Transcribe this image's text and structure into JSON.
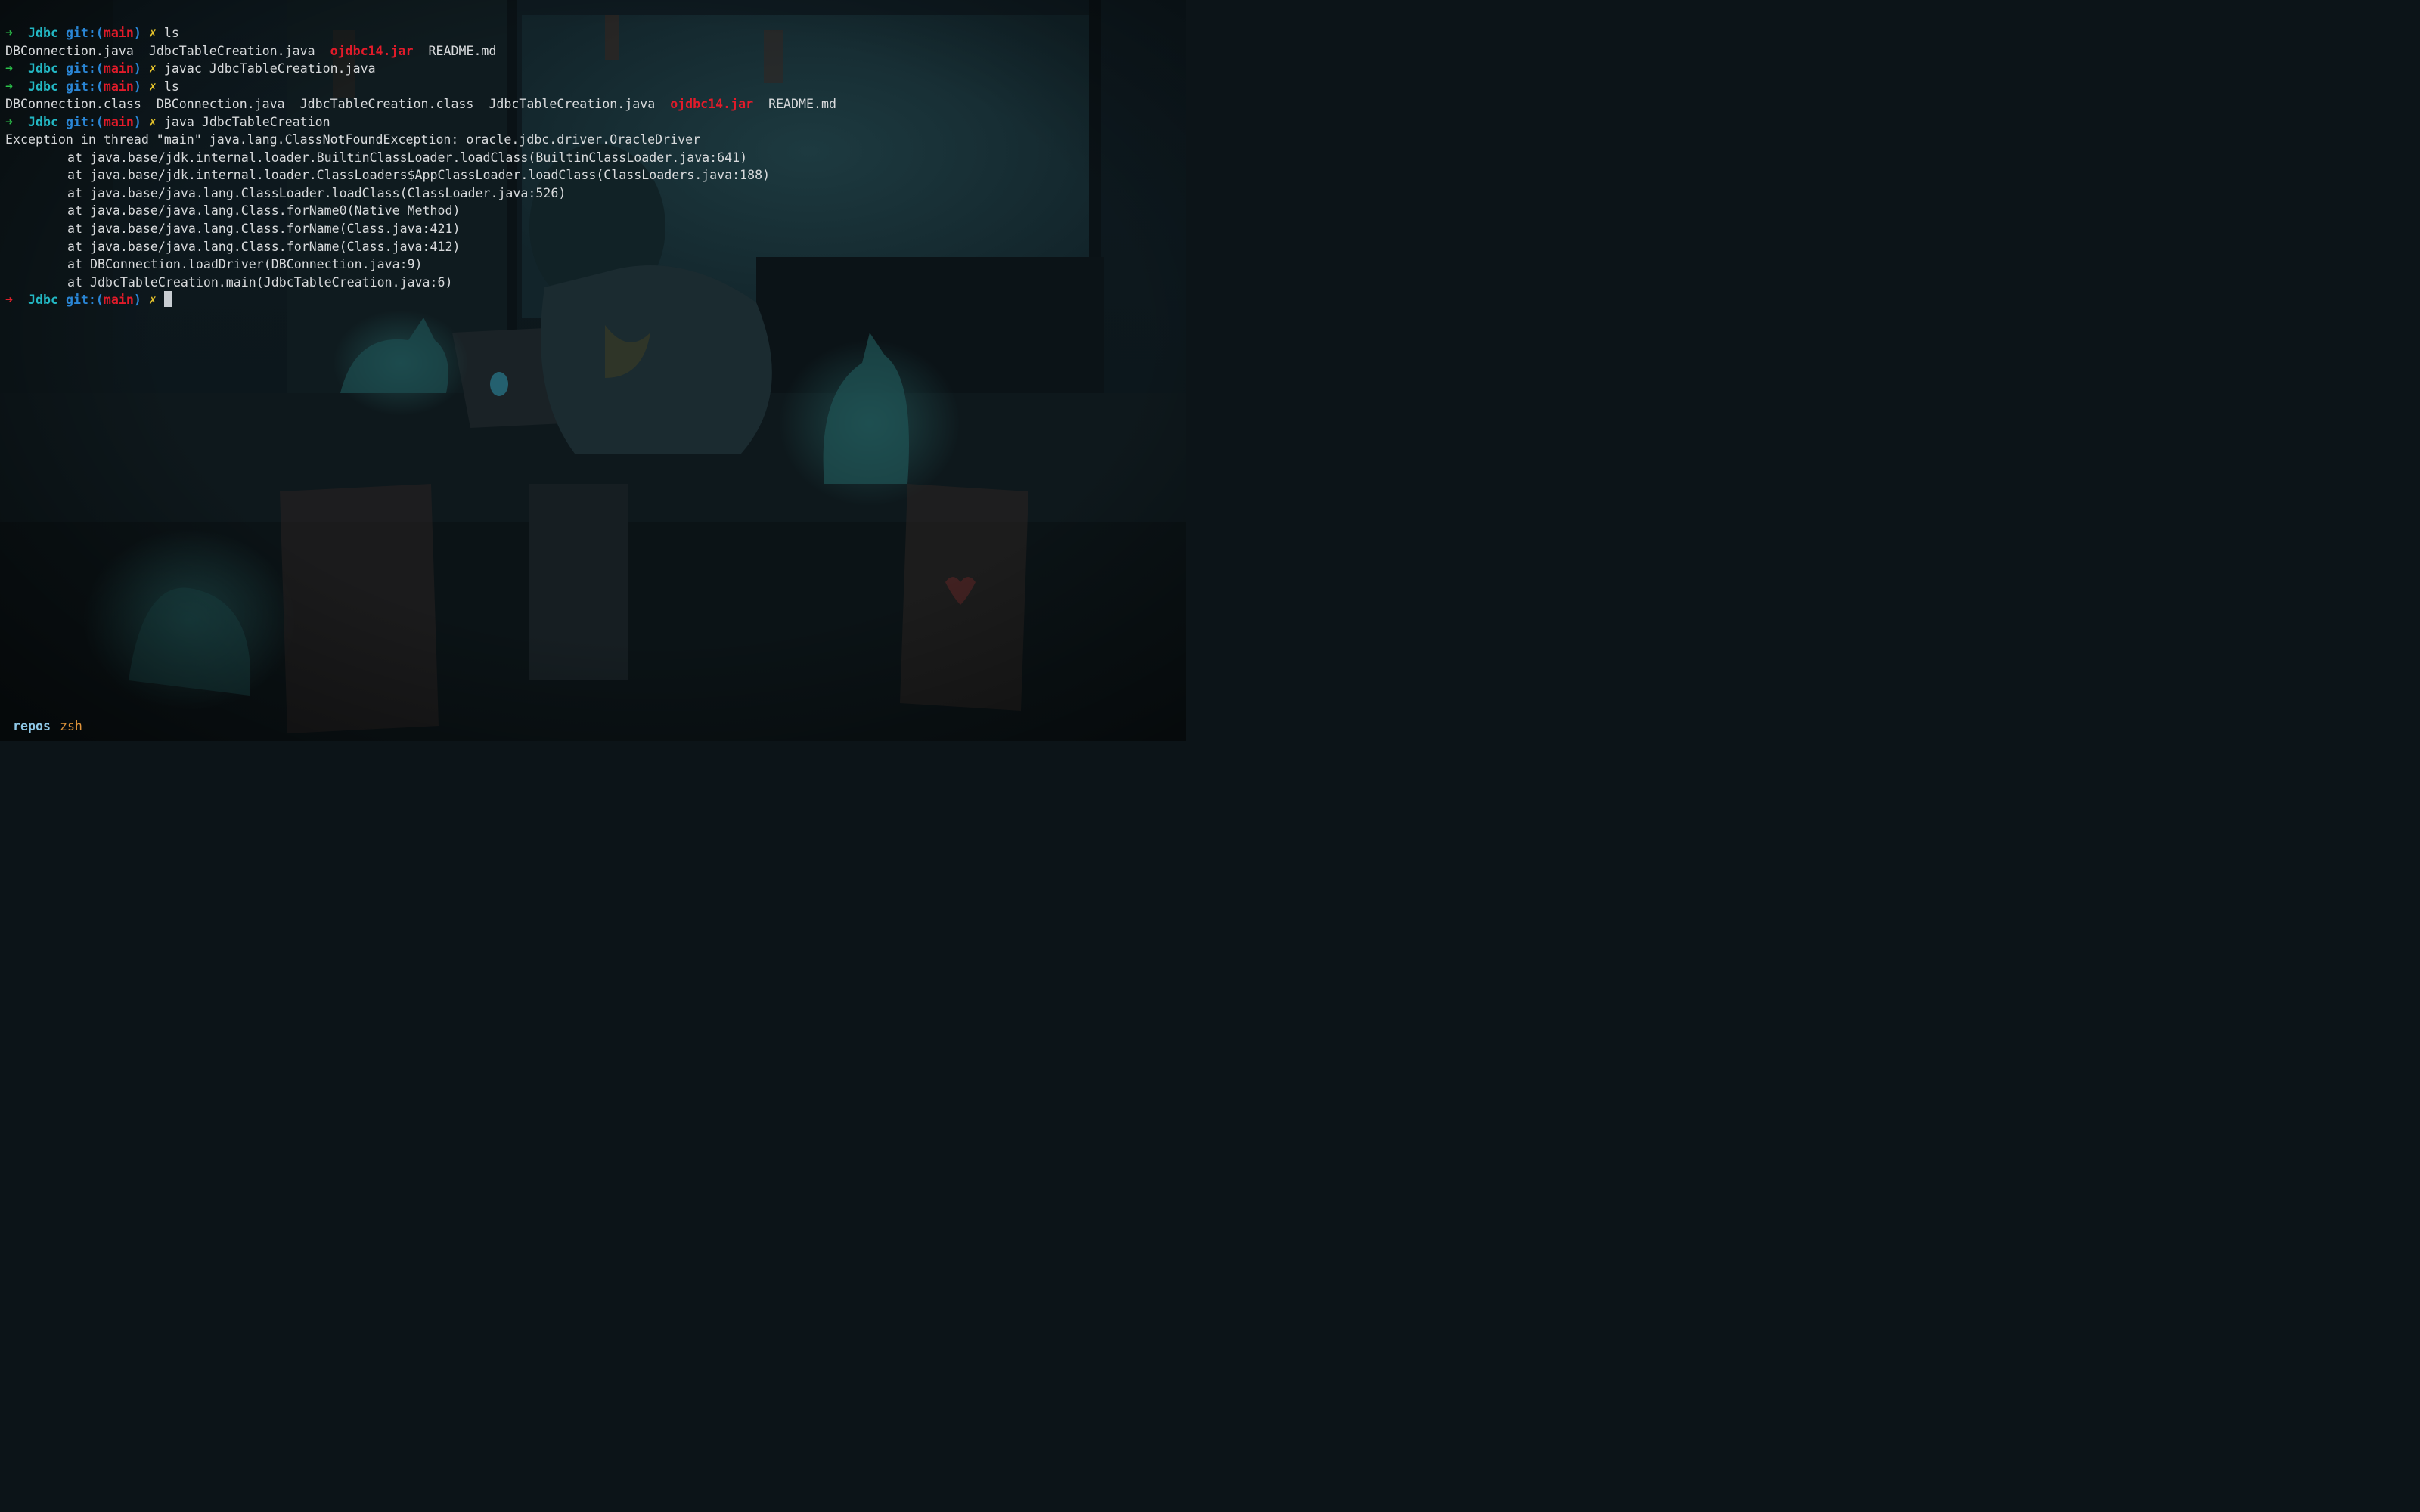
{
  "prompt": {
    "arrow": "➜",
    "dir": "Jdbc",
    "git_prefix": "git:(",
    "branch": "main",
    "git_suffix": ")",
    "dirty": "✗"
  },
  "commands": [
    {
      "text": "ls"
    },
    {
      "text": "javac JdbcTableCreation.java"
    },
    {
      "text": "ls"
    },
    {
      "text": "java JdbcTableCreation"
    }
  ],
  "ls1": [
    "DBConnection.java",
    "JdbcTableCreation.java",
    "ojdbc14.jar",
    "README.md"
  ],
  "ls2": [
    "DBConnection.class",
    "DBConnection.java",
    "JdbcTableCreation.class",
    "JdbcTableCreation.java",
    "ojdbc14.jar",
    "README.md"
  ],
  "exception": "Exception in thread \"main\" java.lang.ClassNotFoundException: oracle.jdbc.driver.OracleDriver",
  "stack": [
    "at java.base/jdk.internal.loader.BuiltinClassLoader.loadClass(BuiltinClassLoader.java:641)",
    "at java.base/jdk.internal.loader.ClassLoaders$AppClassLoader.loadClass(ClassLoaders.java:188)",
    "at java.base/java.lang.ClassLoader.loadClass(ClassLoader.java:526)",
    "at java.base/java.lang.Class.forName0(Native Method)",
    "at java.base/java.lang.Class.forName(Class.java:421)",
    "at java.base/java.lang.Class.forName(Class.java:412)",
    "at DBConnection.loadDriver(DBConnection.java:9)",
    "at JdbcTableCreation.main(JdbcTableCreation.java:6)"
  ],
  "statusbar": {
    "session": "repos",
    "window": "zsh"
  },
  "colors": {
    "arrow_success": "#2bc24a",
    "arrow_error": "#e0202a",
    "dir": "#23b8c4",
    "git": "#2a86d6",
    "branch": "#e21b2a",
    "dirty": "#e5c32b",
    "jar": "#e21b2a",
    "text": "#d8dadc"
  }
}
